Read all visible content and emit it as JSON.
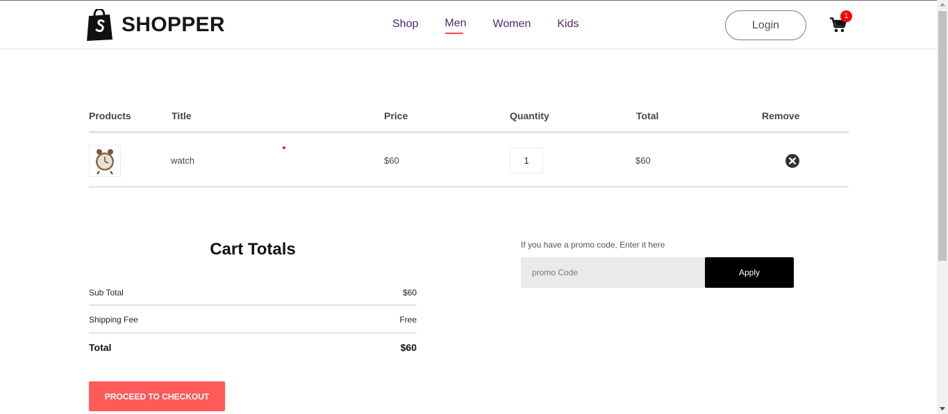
{
  "navbar": {
    "logo_text": "SHOPPER",
    "menu": [
      {
        "label": "Shop"
      },
      {
        "label": "Men"
      },
      {
        "label": "Women"
      },
      {
        "label": "Kids"
      }
    ],
    "active_item": "Men",
    "login_label": "Login",
    "cart_count": "1"
  },
  "cart": {
    "headers": {
      "products": "Products",
      "title": "Title",
      "price": "Price",
      "quantity": "Quantity",
      "total": "Total",
      "remove": "Remove"
    },
    "items": [
      {
        "title": "watch",
        "price": "$60",
        "quantity": "1",
        "total": "$60"
      }
    ]
  },
  "totals": {
    "title": "Cart Totals",
    "subtotal_label": "Sub Total",
    "subtotal_value": "$60",
    "shipping_label": "Shipping Fee",
    "shipping_value": "Free",
    "total_label": "Total",
    "total_value": "$60",
    "checkout_label": "PROCEED TO CHECKOUT"
  },
  "promo": {
    "label": "If you have a promo code, Enter it here",
    "placeholder": "promo Code",
    "apply_label": "Apply"
  },
  "colors": {
    "accent": "#ff5a5a",
    "nav_link": "#4b2a73",
    "badge": "#ff0000"
  }
}
